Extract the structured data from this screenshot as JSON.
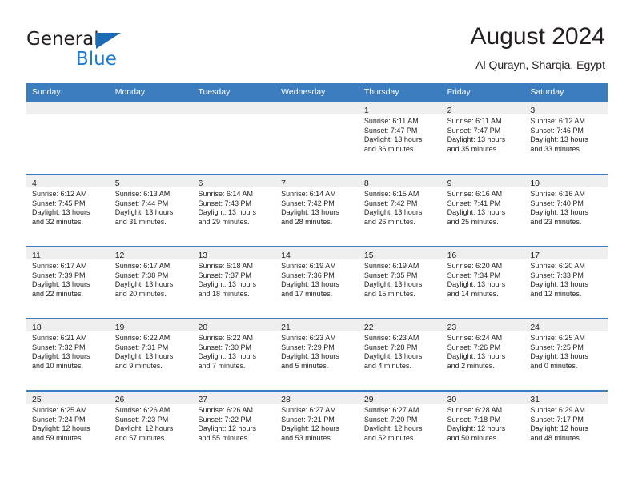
{
  "brand": {
    "name_top": "General",
    "name_bottom": "Blue",
    "triangle_color": "#1b6cb5",
    "blue_color": "#1b7ad4"
  },
  "header": {
    "month_title": "August 2024",
    "location": "Al Qurayn, Sharqia, Egypt"
  },
  "theme": {
    "header_blue": "#3b7dbf",
    "day_band_gray": "#efefef",
    "text": "#231f20"
  },
  "weekdays": [
    "Sunday",
    "Monday",
    "Tuesday",
    "Wednesday",
    "Thursday",
    "Friday",
    "Saturday"
  ],
  "weeks": [
    [
      {
        "day": "",
        "empty": true
      },
      {
        "day": "",
        "empty": true
      },
      {
        "day": "",
        "empty": true
      },
      {
        "day": "",
        "empty": true
      },
      {
        "day": "1",
        "sunrise": "Sunrise: 6:11 AM",
        "sunset": "Sunset: 7:47 PM",
        "daylight1": "Daylight: 13 hours",
        "daylight2": "and 36 minutes."
      },
      {
        "day": "2",
        "sunrise": "Sunrise: 6:11 AM",
        "sunset": "Sunset: 7:47 PM",
        "daylight1": "Daylight: 13 hours",
        "daylight2": "and 35 minutes."
      },
      {
        "day": "3",
        "sunrise": "Sunrise: 6:12 AM",
        "sunset": "Sunset: 7:46 PM",
        "daylight1": "Daylight: 13 hours",
        "daylight2": "and 33 minutes."
      }
    ],
    [
      {
        "day": "4",
        "sunrise": "Sunrise: 6:12 AM",
        "sunset": "Sunset: 7:45 PM",
        "daylight1": "Daylight: 13 hours",
        "daylight2": "and 32 minutes."
      },
      {
        "day": "5",
        "sunrise": "Sunrise: 6:13 AM",
        "sunset": "Sunset: 7:44 PM",
        "daylight1": "Daylight: 13 hours",
        "daylight2": "and 31 minutes."
      },
      {
        "day": "6",
        "sunrise": "Sunrise: 6:14 AM",
        "sunset": "Sunset: 7:43 PM",
        "daylight1": "Daylight: 13 hours",
        "daylight2": "and 29 minutes."
      },
      {
        "day": "7",
        "sunrise": "Sunrise: 6:14 AM",
        "sunset": "Sunset: 7:42 PM",
        "daylight1": "Daylight: 13 hours",
        "daylight2": "and 28 minutes."
      },
      {
        "day": "8",
        "sunrise": "Sunrise: 6:15 AM",
        "sunset": "Sunset: 7:42 PM",
        "daylight1": "Daylight: 13 hours",
        "daylight2": "and 26 minutes."
      },
      {
        "day": "9",
        "sunrise": "Sunrise: 6:16 AM",
        "sunset": "Sunset: 7:41 PM",
        "daylight1": "Daylight: 13 hours",
        "daylight2": "and 25 minutes."
      },
      {
        "day": "10",
        "sunrise": "Sunrise: 6:16 AM",
        "sunset": "Sunset: 7:40 PM",
        "daylight1": "Daylight: 13 hours",
        "daylight2": "and 23 minutes."
      }
    ],
    [
      {
        "day": "11",
        "sunrise": "Sunrise: 6:17 AM",
        "sunset": "Sunset: 7:39 PM",
        "daylight1": "Daylight: 13 hours",
        "daylight2": "and 22 minutes."
      },
      {
        "day": "12",
        "sunrise": "Sunrise: 6:17 AM",
        "sunset": "Sunset: 7:38 PM",
        "daylight1": "Daylight: 13 hours",
        "daylight2": "and 20 minutes."
      },
      {
        "day": "13",
        "sunrise": "Sunrise: 6:18 AM",
        "sunset": "Sunset: 7:37 PM",
        "daylight1": "Daylight: 13 hours",
        "daylight2": "and 18 minutes."
      },
      {
        "day": "14",
        "sunrise": "Sunrise: 6:19 AM",
        "sunset": "Sunset: 7:36 PM",
        "daylight1": "Daylight: 13 hours",
        "daylight2": "and 17 minutes."
      },
      {
        "day": "15",
        "sunrise": "Sunrise: 6:19 AM",
        "sunset": "Sunset: 7:35 PM",
        "daylight1": "Daylight: 13 hours",
        "daylight2": "and 15 minutes."
      },
      {
        "day": "16",
        "sunrise": "Sunrise: 6:20 AM",
        "sunset": "Sunset: 7:34 PM",
        "daylight1": "Daylight: 13 hours",
        "daylight2": "and 14 minutes."
      },
      {
        "day": "17",
        "sunrise": "Sunrise: 6:20 AM",
        "sunset": "Sunset: 7:33 PM",
        "daylight1": "Daylight: 13 hours",
        "daylight2": "and 12 minutes."
      }
    ],
    [
      {
        "day": "18",
        "sunrise": "Sunrise: 6:21 AM",
        "sunset": "Sunset: 7:32 PM",
        "daylight1": "Daylight: 13 hours",
        "daylight2": "and 10 minutes."
      },
      {
        "day": "19",
        "sunrise": "Sunrise: 6:22 AM",
        "sunset": "Sunset: 7:31 PM",
        "daylight1": "Daylight: 13 hours",
        "daylight2": "and 9 minutes."
      },
      {
        "day": "20",
        "sunrise": "Sunrise: 6:22 AM",
        "sunset": "Sunset: 7:30 PM",
        "daylight1": "Daylight: 13 hours",
        "daylight2": "and 7 minutes."
      },
      {
        "day": "21",
        "sunrise": "Sunrise: 6:23 AM",
        "sunset": "Sunset: 7:29 PM",
        "daylight1": "Daylight: 13 hours",
        "daylight2": "and 5 minutes."
      },
      {
        "day": "22",
        "sunrise": "Sunrise: 6:23 AM",
        "sunset": "Sunset: 7:28 PM",
        "daylight1": "Daylight: 13 hours",
        "daylight2": "and 4 minutes."
      },
      {
        "day": "23",
        "sunrise": "Sunrise: 6:24 AM",
        "sunset": "Sunset: 7:26 PM",
        "daylight1": "Daylight: 13 hours",
        "daylight2": "and 2 minutes."
      },
      {
        "day": "24",
        "sunrise": "Sunrise: 6:25 AM",
        "sunset": "Sunset: 7:25 PM",
        "daylight1": "Daylight: 13 hours",
        "daylight2": "and 0 minutes."
      }
    ],
    [
      {
        "day": "25",
        "sunrise": "Sunrise: 6:25 AM",
        "sunset": "Sunset: 7:24 PM",
        "daylight1": "Daylight: 12 hours",
        "daylight2": "and 59 minutes."
      },
      {
        "day": "26",
        "sunrise": "Sunrise: 6:26 AM",
        "sunset": "Sunset: 7:23 PM",
        "daylight1": "Daylight: 12 hours",
        "daylight2": "and 57 minutes."
      },
      {
        "day": "27",
        "sunrise": "Sunrise: 6:26 AM",
        "sunset": "Sunset: 7:22 PM",
        "daylight1": "Daylight: 12 hours",
        "daylight2": "and 55 minutes."
      },
      {
        "day": "28",
        "sunrise": "Sunrise: 6:27 AM",
        "sunset": "Sunset: 7:21 PM",
        "daylight1": "Daylight: 12 hours",
        "daylight2": "and 53 minutes."
      },
      {
        "day": "29",
        "sunrise": "Sunrise: 6:27 AM",
        "sunset": "Sunset: 7:20 PM",
        "daylight1": "Daylight: 12 hours",
        "daylight2": "and 52 minutes."
      },
      {
        "day": "30",
        "sunrise": "Sunrise: 6:28 AM",
        "sunset": "Sunset: 7:18 PM",
        "daylight1": "Daylight: 12 hours",
        "daylight2": "and 50 minutes."
      },
      {
        "day": "31",
        "sunrise": "Sunrise: 6:29 AM",
        "sunset": "Sunset: 7:17 PM",
        "daylight1": "Daylight: 12 hours",
        "daylight2": "and 48 minutes."
      }
    ]
  ]
}
